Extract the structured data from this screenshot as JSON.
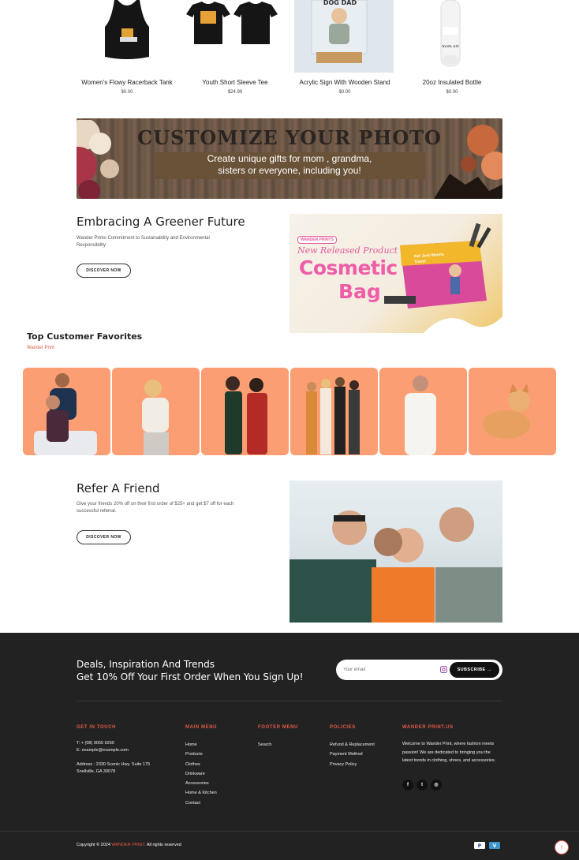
{
  "products": [
    {
      "name": "Women's Flowy Racerback Tank",
      "price": "$0.00",
      "image": "black-tank-top"
    },
    {
      "name": "Youth Short Sleeve Tee",
      "price": "$24.99",
      "image": "black-tees-pair"
    },
    {
      "name": "Acrylic Sign With Wooden Stand",
      "price": "$0.00",
      "image": "acrylic-sign-dog-dad"
    },
    {
      "name": "20oz Insulated Bottle",
      "price": "$0.00",
      "image": "white-bottle"
    }
  ],
  "banner": {
    "headline": "CUSTOMIZE YOUR PHOTO",
    "line1": "Create unique gifts for mom , grandma,",
    "line2": "sisters  or everyone, including you!"
  },
  "green": {
    "title": "Embracing A Greener Future",
    "desc": "Wander Prints Commitment to Sustainability and Environmental Responsibility",
    "button": "DISCOVER NOW"
  },
  "promo": {
    "brand": "WANDER PRINTS",
    "tagline": "New Released Product",
    "word1": "Cosmetic",
    "word2": "Bag",
    "bag_text": "Girl Just Wanna Travel"
  },
  "favorites": {
    "title": "Top Customer Favorites",
    "subtitle": "Wander Print",
    "tiles": [
      "couple",
      "woman-blonde",
      "two-women-suits",
      "group-women",
      "man-white-shirt",
      "cat"
    ],
    "tile_color": "#fb9e74"
  },
  "refer": {
    "title": "Refer A Friend",
    "desc": "Give your friends 20% off on their first order of $25+ and get $7 off for each successful referral.",
    "button": "DISCOVER NOW"
  },
  "newsletter": {
    "line1": "Deals, Inspiration And Trends",
    "line2": "Get 10% Off Your First Order When You Sign Up!",
    "placeholder": "Your email",
    "button": "SUBSCRIBE →"
  },
  "footer": {
    "contact": {
      "title": "GET IN TOUCH",
      "phone": "T: + (08) 9055 0269",
      "email": "E: example@example.com",
      "address1": "Address : 2330 Scenic Hwy. Suite 175",
      "address2": "Snellville, GA 30078"
    },
    "main_menu": {
      "title": "MAIN MENU",
      "items": [
        "Home",
        "Products",
        "Clothes",
        "Drinkware",
        "Accessories",
        "Home & Kitchen",
        "Contact"
      ]
    },
    "footer_menu": {
      "title": "FOOTER MENU",
      "items": [
        "Search"
      ]
    },
    "policies": {
      "title": "POLICIES",
      "items": [
        "Refund & Replacement",
        "Payment Method",
        "Privacy Policy"
      ]
    },
    "about": {
      "title": "WANDER PRINT.US",
      "text": "Welcome to Wander Print, where fashion meets passion! We are dedicated to bringing you the latest trends in clothing, shoes, and accessories.",
      "social": [
        "facebook-icon",
        "twitter-icon",
        "instagram-icon"
      ]
    },
    "copyright_pre": "Copyright © 2024",
    "copyright_brand": "WANDER PRINT.",
    "copyright_post": "All rights reserved",
    "payments": [
      "paypal",
      "venmo"
    ]
  },
  "colors": {
    "accent": "#e05a47",
    "footer_bg": "#222222",
    "tile": "#fb9e74"
  }
}
